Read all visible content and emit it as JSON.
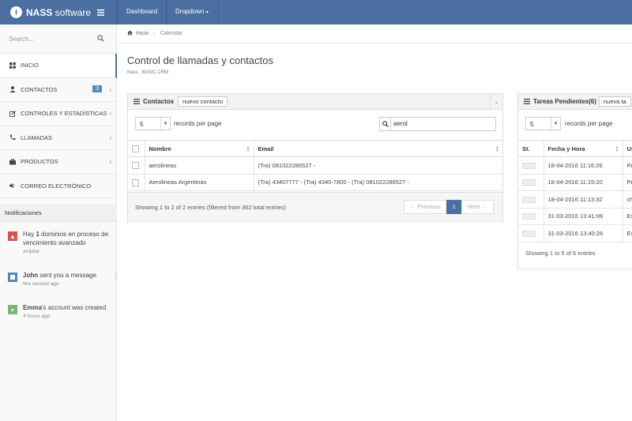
{
  "topbar": {
    "brand_bold": "NASS",
    "brand_rest": " software",
    "nav": [
      "Dashboard",
      "Dropdown"
    ]
  },
  "sidebar": {
    "search_placeholder": "Search...",
    "items": [
      {
        "label": "INICIO"
      },
      {
        "label": "CONTACTOS",
        "badge": "3"
      },
      {
        "label": "CONTROLES Y ESTADÍSTICAS"
      },
      {
        "label": "LLAMADAS"
      },
      {
        "label": "PRODUCTOS"
      },
      {
        "label": "CORREO ELECTRÓNICO"
      }
    ]
  },
  "notifications": {
    "title": "Notificaciones",
    "items": [
      {
        "text_pre": "Hay ",
        "text_bold": "1",
        "text_post": " dominios en proceso de vencimiento avanzado",
        "time": "ampliar",
        "color": "#d9534f"
      },
      {
        "text_pre": "",
        "text_bold": "John",
        "text_post": " sent you a message",
        "time": "few second ago",
        "color": "#5b86b8"
      },
      {
        "text_pre": "",
        "text_bold": "Emma",
        "text_post": "'s account was created",
        "time": "4 hours ago",
        "color": "#7fb27f"
      }
    ]
  },
  "breadcrumb": {
    "home": "Inicio",
    "current": "Calendar"
  },
  "page": {
    "title": "Control de llamadas y contactos",
    "subtitle": "Nass . BASIC CRM"
  },
  "contacts": {
    "title": "Contactos",
    "new_button": "nuevo contacto",
    "page_size": "5",
    "records_label": "records per page",
    "search_value": "aerol",
    "columns": [
      "Nombre",
      "Email"
    ],
    "rows": [
      {
        "name": "aerolineas",
        "email": "(Tra) 081022286527 -"
      },
      {
        "name": "Aerolineas Argentinas",
        "email": "(Tra) 43407777 - (Tra) 4340-7800 - (Tra) 081022286527 -"
      }
    ],
    "info": "Showing 1 to 2 of 2 entries (filtered from 362 total entries)",
    "prev": "← Previous",
    "page": "1",
    "next": "Next →"
  },
  "tasks": {
    "title": "Tareas Pendientes(6)",
    "new_button": "nueva ta",
    "page_size": "5",
    "records_label": "records per page",
    "columns": [
      "St.",
      "Fecha y Hora",
      "Us"
    ],
    "rows": [
      {
        "date": "18-04-2016 11:16:26",
        "user": "PA"
      },
      {
        "date": "18-04-2016 11:15:20",
        "user": "PA"
      },
      {
        "date": "18-04-2016 11:13:32",
        "user": "ch"
      },
      {
        "date": "31-03-2016 13:41:06",
        "user": "Es"
      },
      {
        "date": "31-03-2016 13:40:26",
        "user": "Es"
      }
    ],
    "info": "Showing 1 to 5 of 6 entries"
  }
}
